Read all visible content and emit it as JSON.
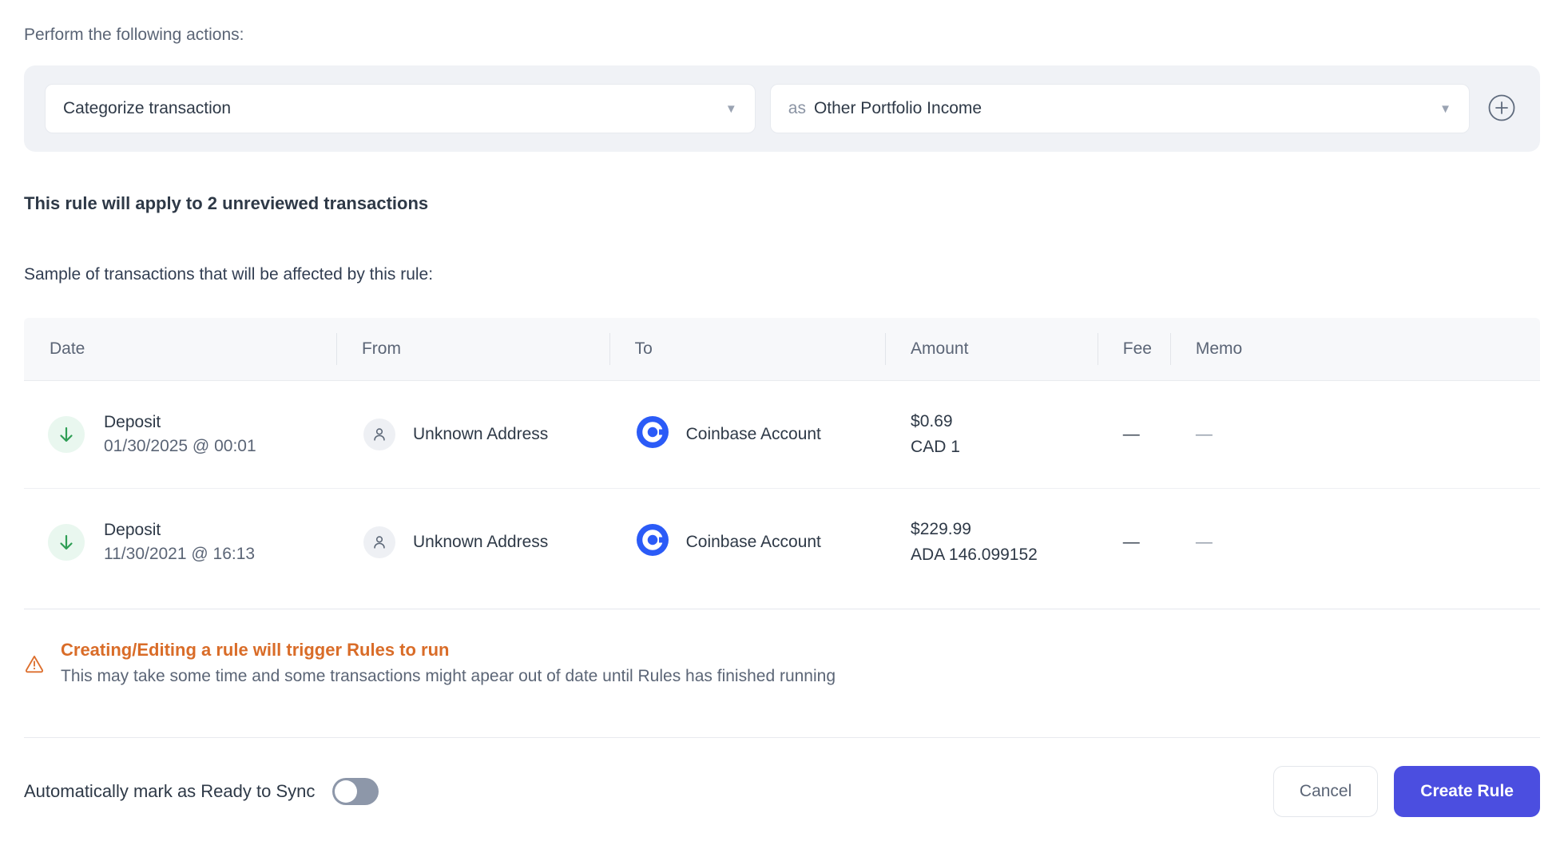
{
  "actions": {
    "label": "Perform the following actions:",
    "action_select": {
      "value": "Categorize transaction"
    },
    "category_select": {
      "prefix": "as",
      "value": "Other Portfolio Income"
    }
  },
  "rule_summary": "This rule will apply to 2 unreviewed transactions",
  "sample_label": "Sample of transactions that will be affected by this rule:",
  "table": {
    "headers": [
      "Date",
      "From",
      "To",
      "Amount",
      "Fee",
      "Memo"
    ],
    "rows": [
      {
        "type": "Deposit",
        "datetime": "01/30/2025 @ 00:01",
        "from": "Unknown Address",
        "to": "Coinbase Account",
        "amount_fiat": "$0.69",
        "amount_crypto": "CAD 1",
        "fee": "—",
        "memo": "—"
      },
      {
        "type": "Deposit",
        "datetime": "11/30/2021 @ 16:13",
        "from": "Unknown Address",
        "to": "Coinbase Account",
        "amount_fiat": "$229.99",
        "amount_crypto": "ADA 146.099152",
        "fee": "—",
        "memo": "—"
      }
    ]
  },
  "warning": {
    "title": "Creating/Editing a rule will trigger Rules to run",
    "description": "This may take some time and some transactions might apear out of date until Rules has finished running"
  },
  "footer": {
    "toggle_label": "Automatically mark as Ready to Sync",
    "toggle_state": "off",
    "cancel_label": "Cancel",
    "create_label": "Create Rule"
  },
  "colors": {
    "accent_indigo": "#4b4ee0",
    "coinbase_blue": "#2b5bf7",
    "deposit_green": "#2f9e55",
    "warning_orange": "#d96c28",
    "panel_gray": "#f0f2f6"
  }
}
